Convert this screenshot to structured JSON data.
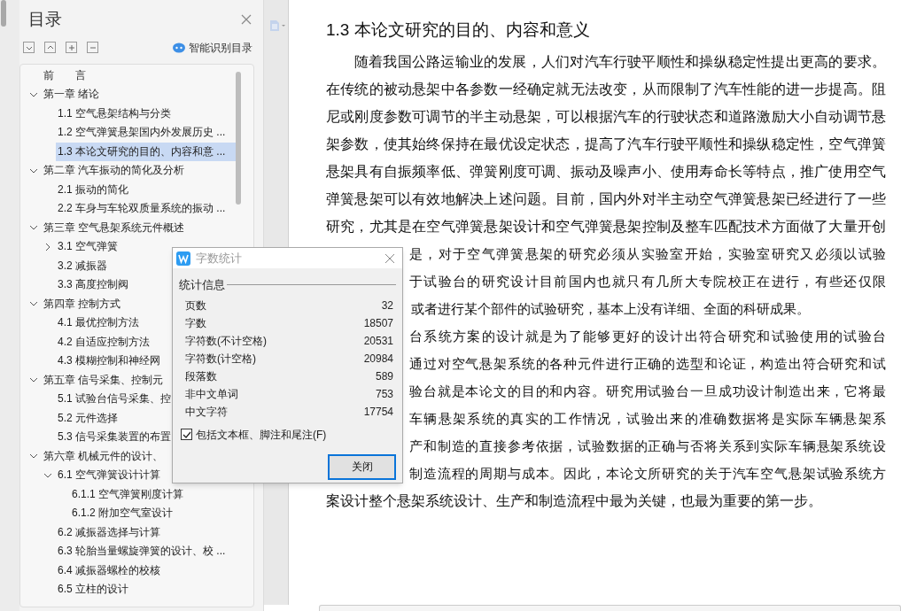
{
  "toc_panel": {
    "title": "目录",
    "smart_button": "智能识别目录",
    "items": [
      {
        "label": "前　　言"
      },
      {
        "label": "第一章  绪论",
        "expanded": true,
        "children": [
          {
            "label": "1.1 空气悬架结构与分类",
            "selected": false
          },
          {
            "label": "1.2 空气弹簧悬架国内外发展历史 ...",
            "selected": false
          },
          {
            "label": "1.3 本论文研究的目的、内容和意 ...",
            "selected": true
          }
        ]
      },
      {
        "label": "第二章  汽车振动的简化及分析",
        "expanded": true,
        "children": [
          {
            "label": "2.1 振动的简化",
            "selected": false
          },
          {
            "label": "2.2 车身与车轮双质量系统的振动 ...",
            "selected": false
          }
        ]
      },
      {
        "label": "第三章  空气悬架系统元件概述",
        "expanded": true,
        "children": [
          {
            "label": "3.1 空气弹簧",
            "expanded": false,
            "selected": false
          },
          {
            "label": "3.2 减振器",
            "selected": false
          },
          {
            "label": "3.3 高度控制阀",
            "selected": false
          }
        ]
      },
      {
        "label": "第四章  控制方式",
        "expanded": true,
        "children": [
          {
            "label": "4.1 最优控制方法",
            "selected": false
          },
          {
            "label": "4.2 自适应控制方法",
            "selected": false
          },
          {
            "label": "4.3 模糊控制和神经网",
            "selected": false
          }
        ]
      },
      {
        "label": "第五章  信号采集、控制元",
        "expanded": true,
        "children": [
          {
            "label": "5.1 试验台信号采集、控",
            "selected": false
          },
          {
            "label": "5.2 元件选择",
            "selected": false
          },
          {
            "label": "5.3 信号采集装置的布置",
            "selected": false
          }
        ]
      },
      {
        "label": "第六章  机械元件的设计、",
        "expanded": true,
        "children": [
          {
            "label": "6.1 空气弹簧设计计算",
            "expanded": true,
            "selected": false,
            "children": [
              {
                "label": "6.1.1 空气弹簧刚度计算",
                "selected": false
              },
              {
                "label": "6.1.2 附加空气室设计",
                "selected": false
              }
            ]
          },
          {
            "label": "6.2 减振器选择与计算",
            "selected": false
          },
          {
            "label": "6.3 轮胎当量螺旋弹簧的设计、校 ...",
            "selected": false
          },
          {
            "label": "6.4  减振器螺栓的校核",
            "selected": false
          },
          {
            "label": "6.5  立柱的设计",
            "selected": false
          }
        ]
      }
    ]
  },
  "document": {
    "heading": "1.3 本论文研究的目的、内容和意义",
    "lines": [
      {
        "kind": "first",
        "text": "随着我国公路运输业的发展，人们对汽车行驶平顺性和操纵稳定性提出更高的要求。"
      },
      {
        "kind": "full",
        "text": "在传统的被动悬架中各参数一经确定就无法改变，从而限制了汽车性能的进一步提高。阻"
      },
      {
        "kind": "full",
        "text": "尼或刚度参数可调节的半主动悬架，可以根据汽车的行驶状态和道路激励大小自动调节悬"
      },
      {
        "kind": "full",
        "text": "架参数，使其始终保持在最优设定状态，提高了汽车行驶平顺性和操纵稳定性，空气弹簧"
      },
      {
        "kind": "full",
        "text": "悬架具有自振频率低、弹簧刚度可调、振动及噪声小、使用寿命长等特点，推广使用空气"
      },
      {
        "kind": "full",
        "text": "弹簧悬架可以有效地解决上述问题。目前，国内外对半主动空气弹簧悬架已经进行了一些"
      },
      {
        "kind": "full",
        "text": "研究，尤其是在空气弹簧悬架设计和空气弹簧悬架控制及整车匹配技术方面做了大量开创"
      },
      {
        "kind": "cut",
        "text": "是，对于空气弹簧悬架的研究必须从实验室开始，实验室研究又必须以试验"
      },
      {
        "kind": "cut",
        "text": "于试验台的研究设计目前国内也就只有几所大专院校正在进行，有些还仅限"
      },
      {
        "kind": "cut_last",
        "text": "或者进行某个部件的试验研究，基本上没有详细、全面的科研成果。"
      },
      {
        "kind": "cut",
        "text": "台系统方案的设计就是为了能够更好的设计出符合研究和试验使用的试验台"
      },
      {
        "kind": "cut",
        "text": "通过对空气悬架系统的各种元件进行正确的选型和论证，构造出符合研究和试"
      },
      {
        "kind": "cut",
        "text": "验台就是本论文的目的和内容。研究用试验台一旦成功设计制造出来，它将最"
      },
      {
        "kind": "cut",
        "text": "车辆悬架系统的真实的工作情况，试验出来的准确数据将是实际车辆悬架系"
      },
      {
        "kind": "cut",
        "text": "产和制造的直接参考依据，试验数据的正确与否将关系到实际车辆悬架系统设"
      },
      {
        "kind": "cut",
        "text": "制造流程的周期与成本。因此，本论文所研究的关于汽车空气悬架试验系统方"
      },
      {
        "kind": "last",
        "text": "案设计整个悬架系统设计、生产和制造流程中最为关键，也最为重要的第一步。"
      }
    ]
  },
  "word_count_dialog": {
    "title": "字数统计",
    "group_label": "统计信息",
    "stats": [
      {
        "label": "页数",
        "value": "32"
      },
      {
        "label": "字数",
        "value": "18507"
      },
      {
        "label": "字符数(不计空格)",
        "value": "20531"
      },
      {
        "label": "字符数(计空格)",
        "value": "20984"
      },
      {
        "label": "段落数",
        "value": "589"
      },
      {
        "label": "非中文单词",
        "value": "753"
      },
      {
        "label": "中文字符",
        "value": "17754"
      }
    ],
    "include_option": {
      "label": "包括文本框、脚注和尾注(F)",
      "checked": true
    },
    "close_button": "关闭"
  }
}
